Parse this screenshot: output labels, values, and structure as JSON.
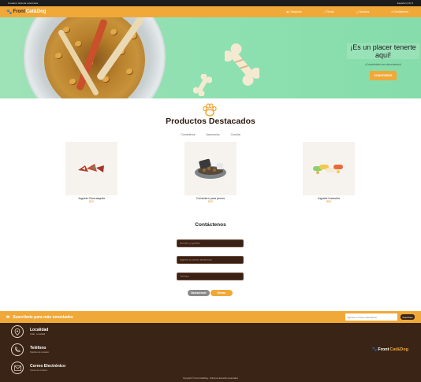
{
  "topbar": {
    "left_text": "Creados: Historia veterinaria",
    "right_text": "Español (US) ▾"
  },
  "nav": {
    "logo_part1": "Front",
    "logo_part2": "Cat&Dog",
    "links": [
      {
        "label": "Categorías",
        "icon": "grid-icon"
      },
      {
        "label": "Tienda",
        "icon": "store-icon"
      },
      {
        "label": "Nosotros",
        "icon": "info-icon"
      },
      {
        "label": "Contáctenos",
        "icon": "mail-icon"
      }
    ]
  },
  "hero": {
    "title": "¡Es un placer tenerte aquí!",
    "subtitle": "¡Consiéntalo con descuentos!",
    "button": "CONOCENOS"
  },
  "products_section": {
    "icon": "paw-icon",
    "title": "Productos Destacados",
    "filters": [
      "Comederos",
      "Accesorios",
      "Comida"
    ],
    "items": [
      {
        "name": "Juguete Churrasquito",
        "price": "$20"
      },
      {
        "name": "Comedero para perros",
        "price": "$25"
      },
      {
        "name": "Juguete hueso/bo",
        "price": "$85"
      }
    ]
  },
  "contact": {
    "title": "Contáctenos",
    "fields": [
      {
        "placeholder": "Nombre y Apellido"
      },
      {
        "placeholder": "Ingrese su correo electrónico"
      },
      {
        "placeholder": "Teléfono"
      }
    ],
    "reset_button": "Borrar/reset",
    "send_button": "Enviar"
  },
  "subscribe": {
    "text": "Suscribete para más novedades",
    "input_placeholder": "Ingrese tu correo electrónico",
    "button": "Suscríbete"
  },
  "footer": {
    "items": [
      {
        "label": "Localidad",
        "sub": "Calle , Localidad",
        "icon": "location-icon"
      },
      {
        "label": "Teléfono",
        "sub": "Telefono de contacto",
        "icon": "phone-icon"
      },
      {
        "label": "Correo Electrónico",
        "sub": "Correo de contacto",
        "icon": "email-icon"
      }
    ],
    "logo_part1": "Front",
    "logo_part2": "Cat&Dog",
    "copyright": "Copyright © Front Cat&Dog - Todos los derechos reservados"
  },
  "colors": {
    "accent": "#f0a938",
    "brown": "#3a2415",
    "hero_green": "#8ee0b1"
  }
}
